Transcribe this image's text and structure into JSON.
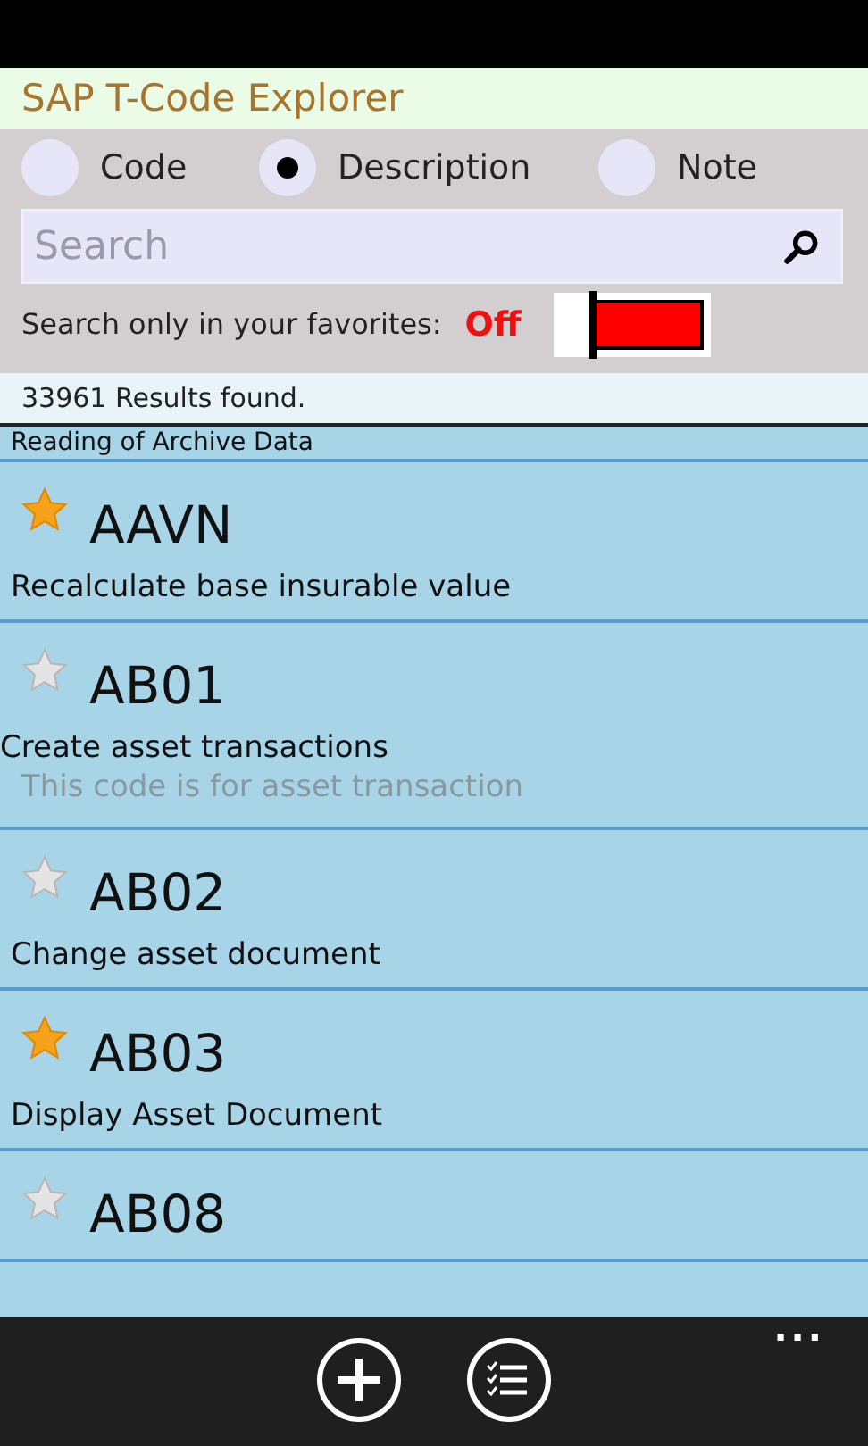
{
  "app_title": "SAP T-Code Explorer",
  "search_modes": [
    {
      "label": "Code",
      "selected": false
    },
    {
      "label": "Description",
      "selected": true
    },
    {
      "label": "Note",
      "selected": false
    }
  ],
  "search": {
    "placeholder": "Search"
  },
  "favorites_filter": {
    "label": "Search only in your favorites:",
    "state_text": "Off",
    "on": false
  },
  "results_count": "33961 Results found.",
  "partial_item": {
    "description": "Reading of Archive Data"
  },
  "items": [
    {
      "code": "AAVN",
      "description": "Recalculate base insurable value",
      "favorite": true
    },
    {
      "code": "AB01",
      "description": "Create asset transactions",
      "note": "This code is for asset transaction",
      "favorite": false
    },
    {
      "code": "AB02",
      "description": "Change asset document",
      "favorite": false
    },
    {
      "code": "AB03",
      "description": "Display Asset Document",
      "favorite": true
    },
    {
      "code": "AB08",
      "favorite": false
    }
  ],
  "app_bar": {
    "more": "..."
  }
}
